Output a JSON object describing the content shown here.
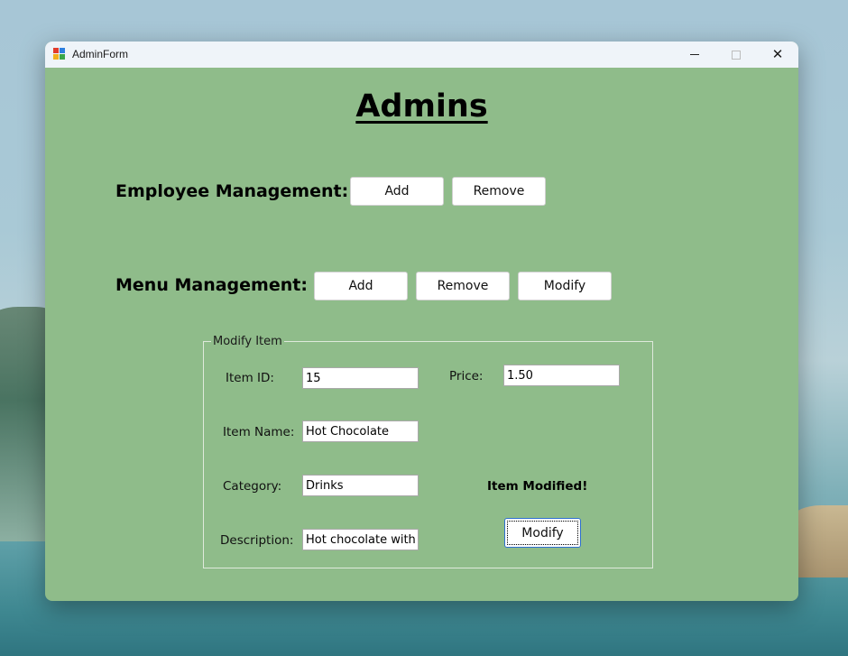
{
  "window": {
    "title": "AdminForm",
    "controls": {
      "minimize": "minimize",
      "maximize": "maximize",
      "close": "close"
    }
  },
  "page": {
    "heading": "Admins"
  },
  "employee_management": {
    "label": "Employee Management:",
    "add_label": "Add",
    "remove_label": "Remove"
  },
  "menu_management": {
    "label": "Menu Management:",
    "add_label": "Add",
    "remove_label": "Remove",
    "modify_label": "Modify"
  },
  "modify_item": {
    "group_title": "Modify Item",
    "item_id": {
      "label": "Item ID:",
      "value": "15"
    },
    "price": {
      "label": "Price:",
      "value": "1.50"
    },
    "item_name": {
      "label": "Item Name:",
      "value": "Hot Chocolate"
    },
    "category": {
      "label": "Category:",
      "value": "Drinks"
    },
    "description": {
      "label": "Description:",
      "value": "Hot chocolate with v"
    },
    "status_text": "Item Modified!",
    "submit_label": "Modify"
  },
  "icons": {
    "app": "app-icon",
    "minimize": "minimize-icon",
    "maximize": "maximize-icon",
    "close": "close-icon"
  },
  "colors": {
    "form_background": "#8fbc8a",
    "titlebar": "#eff4f9",
    "button_background": "#ffffff",
    "focus_border": "#2f6fd0"
  }
}
